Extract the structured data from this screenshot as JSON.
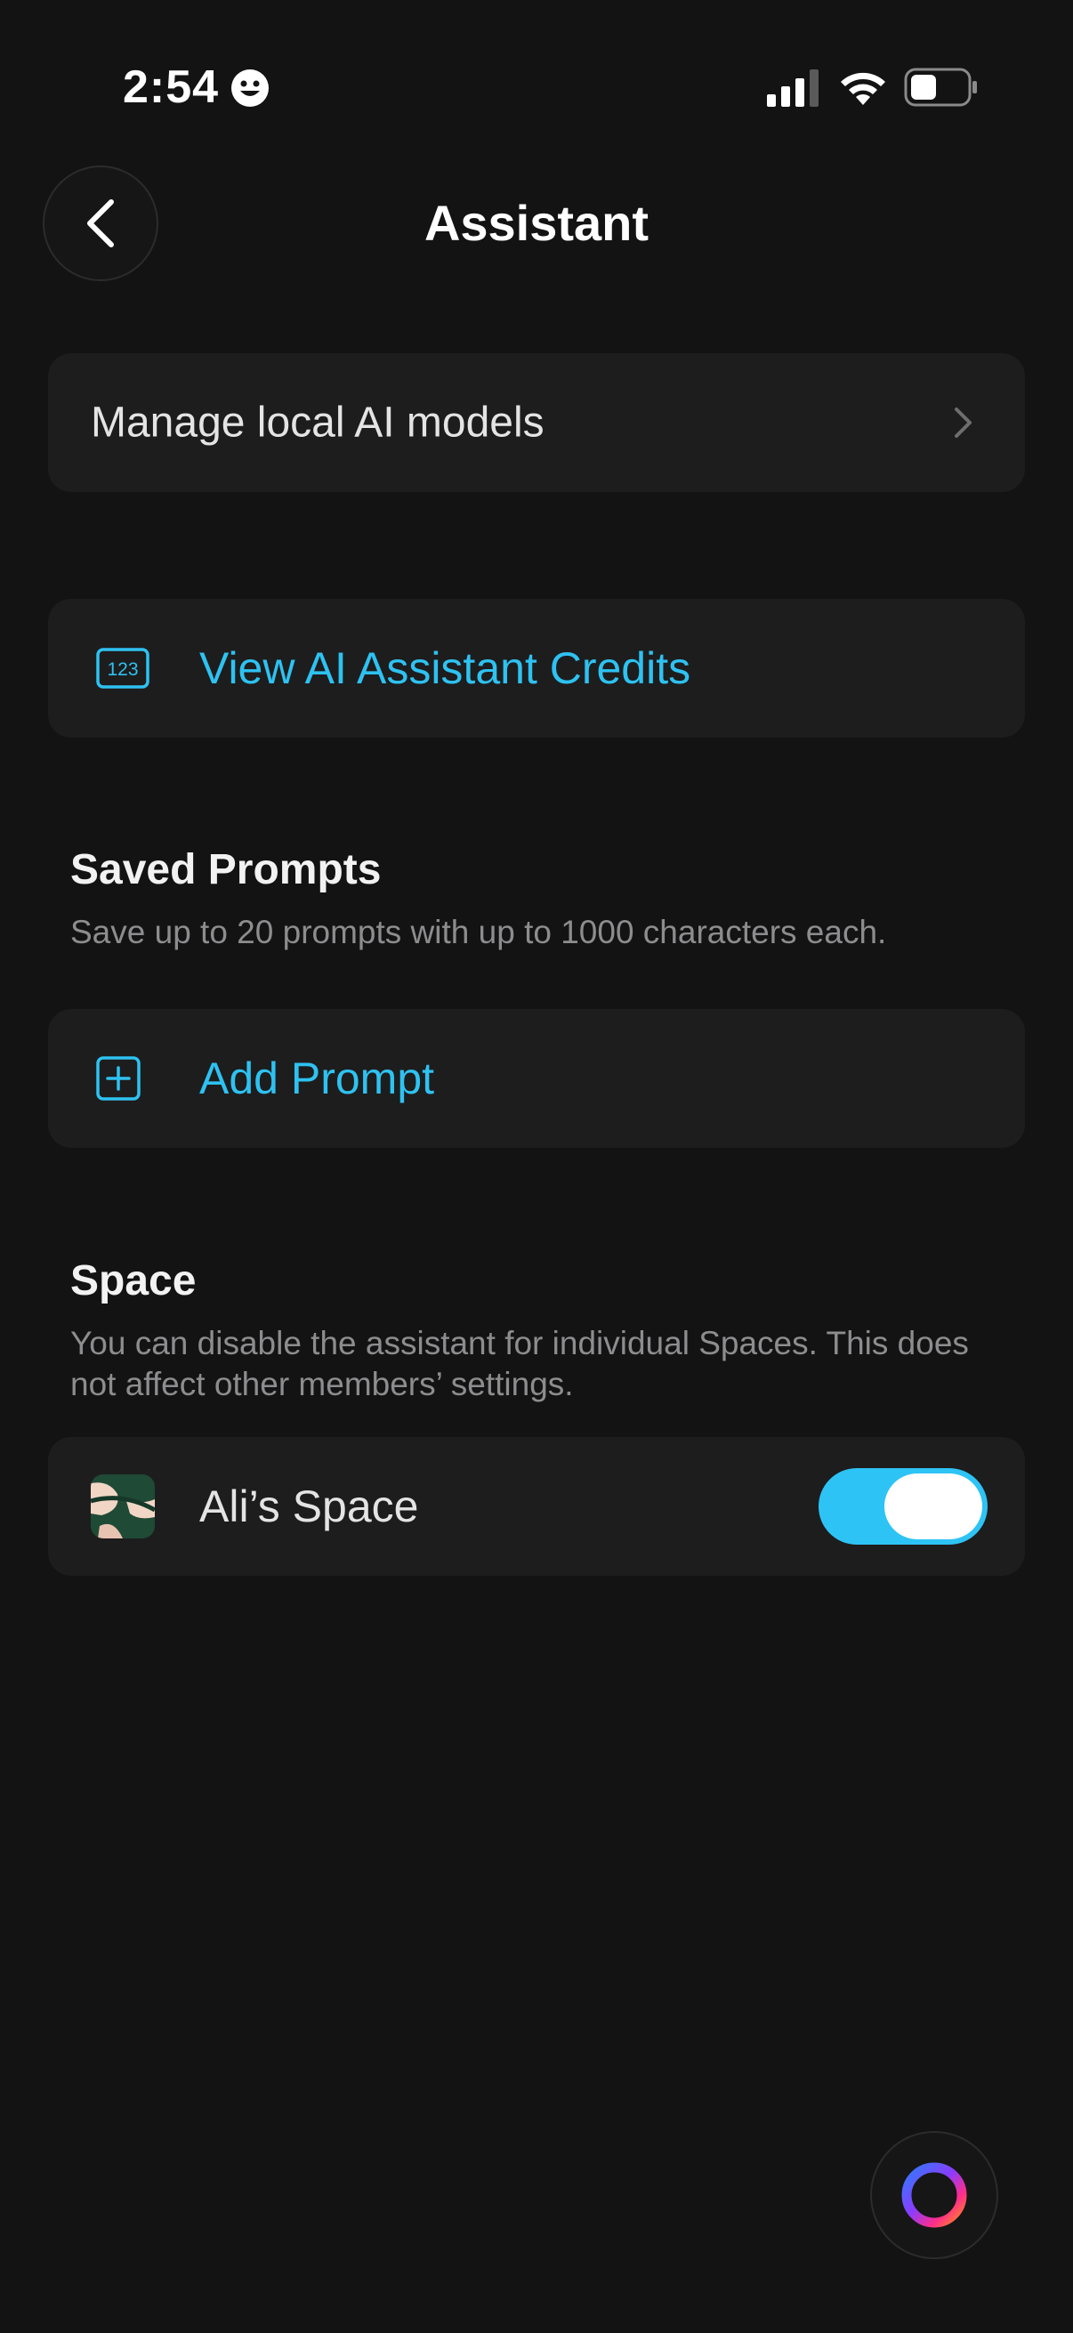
{
  "status_bar": {
    "time": "2:54"
  },
  "header": {
    "title": "Assistant"
  },
  "manage_models": {
    "label": "Manage local AI models"
  },
  "credits": {
    "label": "View AI Assistant Credits",
    "icon_text": "123"
  },
  "saved_prompts": {
    "title": "Saved Prompts",
    "description": "Save up to 20 prompts with up to 1000 characters each.",
    "add_label": "Add Prompt"
  },
  "space": {
    "title": "Space",
    "description": "You can disable the assistant for individual Spaces. This does not affect other members’ settings.",
    "items": [
      {
        "name": "Ali’s Space",
        "enabled": true
      }
    ]
  },
  "colors": {
    "background": "#131313",
    "card": "#1d1d1e",
    "accent": "#2ec2f1",
    "muted_text": "#8d8d8f"
  }
}
